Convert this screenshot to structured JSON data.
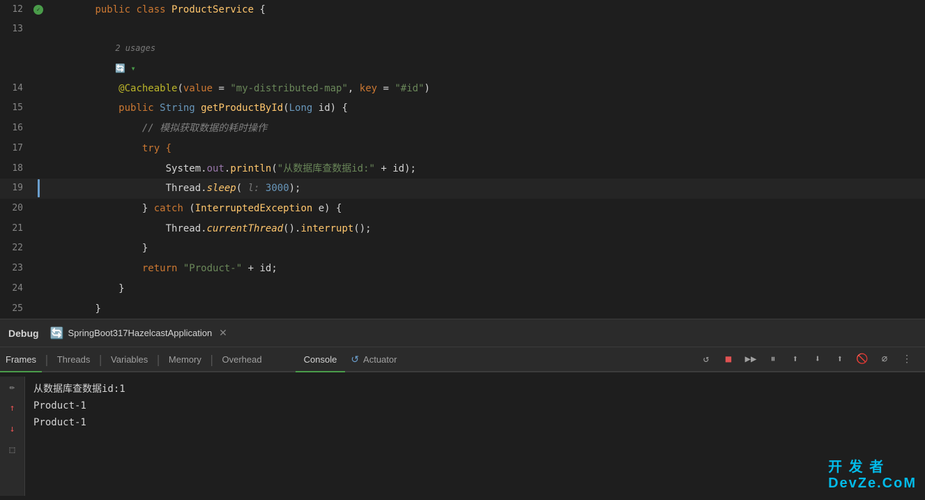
{
  "editor": {
    "lines": [
      {
        "num": "12",
        "gutter": "green-dot",
        "content": "public class ProductService {"
      },
      {
        "num": "13",
        "content": ""
      },
      {
        "num": "",
        "content": "    2 usages"
      },
      {
        "num": "",
        "content": "    🔄 ▾"
      },
      {
        "num": "14",
        "content": "    @Cacheable(value = \"my-distributed-map\", key = \"#id\")"
      },
      {
        "num": "15",
        "content": "    public String getProductById(Long id) {"
      },
      {
        "num": "16",
        "content": "        // 模拟获取数据的耗时操作"
      },
      {
        "num": "17",
        "content": "        try {"
      },
      {
        "num": "18",
        "content": "            System.out.println(\"从数据库查数据id:\" + id);"
      },
      {
        "num": "19",
        "content": "            Thread.sleep( l: 3000);"
      },
      {
        "num": "20",
        "content": "        } catch (InterruptedException e) {"
      },
      {
        "num": "21",
        "content": "            Thread.currentThread().interrupt();"
      },
      {
        "num": "22",
        "content": "        }"
      },
      {
        "num": "23",
        "content": "        return \"Product-\" + id;"
      },
      {
        "num": "24",
        "content": "    }"
      },
      {
        "num": "25",
        "content": "}"
      }
    ]
  },
  "debug": {
    "title": "Debug",
    "session_label": "SpringBoot317HazelcastApplication",
    "tabs": [
      "Frames",
      "Threads",
      "Variables",
      "Memory",
      "Overhead"
    ],
    "console_label": "Console",
    "actuator_label": "Actuator",
    "tab_separator": "|"
  },
  "console": {
    "lines": [
      "从数据库查数据id:1",
      "Product-1",
      "Product-1"
    ]
  },
  "watermark": {
    "line1": "开 发 者",
    "line2": "DevZe.CoM"
  }
}
